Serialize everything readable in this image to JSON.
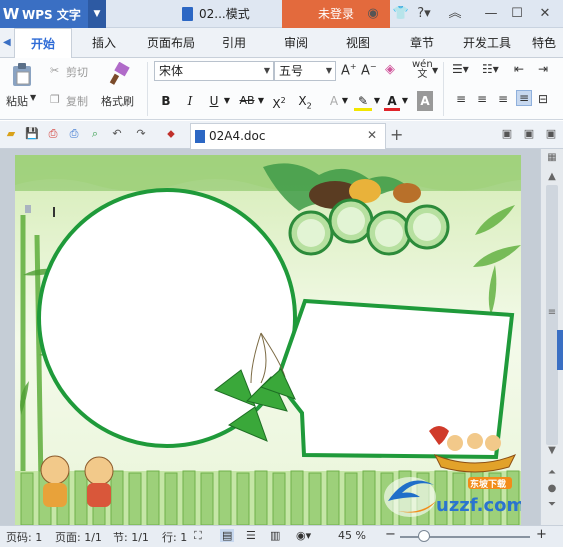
{
  "app": {
    "name": "WPS 文字",
    "logo_glyph": "W",
    "window_title": "02...模式",
    "login_label": "未登录"
  },
  "ribbon_tabs": [
    "开始",
    "插入",
    "页面布局",
    "引用",
    "审阅",
    "视图",
    "章节",
    "开发工具",
    "特色"
  ],
  "ribbon": {
    "paste_label": "粘贴",
    "cut_label": "剪切",
    "copy_label": "复制",
    "format_painter_label": "格式刷",
    "font_name": "宋体",
    "font_size": "五号"
  },
  "document_tab": {
    "name": "02A4.doc"
  },
  "status": {
    "page_number": "页码: 1",
    "pages": "页面: 1/1",
    "section": "节: 1/1",
    "row": "行: 1",
    "zoom": "45 %",
    "zoom_minus": "−",
    "zoom_plus": "+"
  },
  "watermark": {
    "brand": "uzzf.com",
    "site": "东坡下载"
  },
  "colors": {
    "accent": "#2e6bd6",
    "title_bar": "#dfe7f2",
    "logo_bg": "#3a6fc3",
    "login_bg": "#e36a3d",
    "frame_green": "#1f9a3a"
  },
  "icons": {
    "paste": "clipboard-icon",
    "cut": "scissors-icon",
    "copy": "copy-icon",
    "format_painter": "paintbrush-icon",
    "bold": "bold-icon",
    "italic": "italic-icon",
    "underline": "underline-icon"
  }
}
